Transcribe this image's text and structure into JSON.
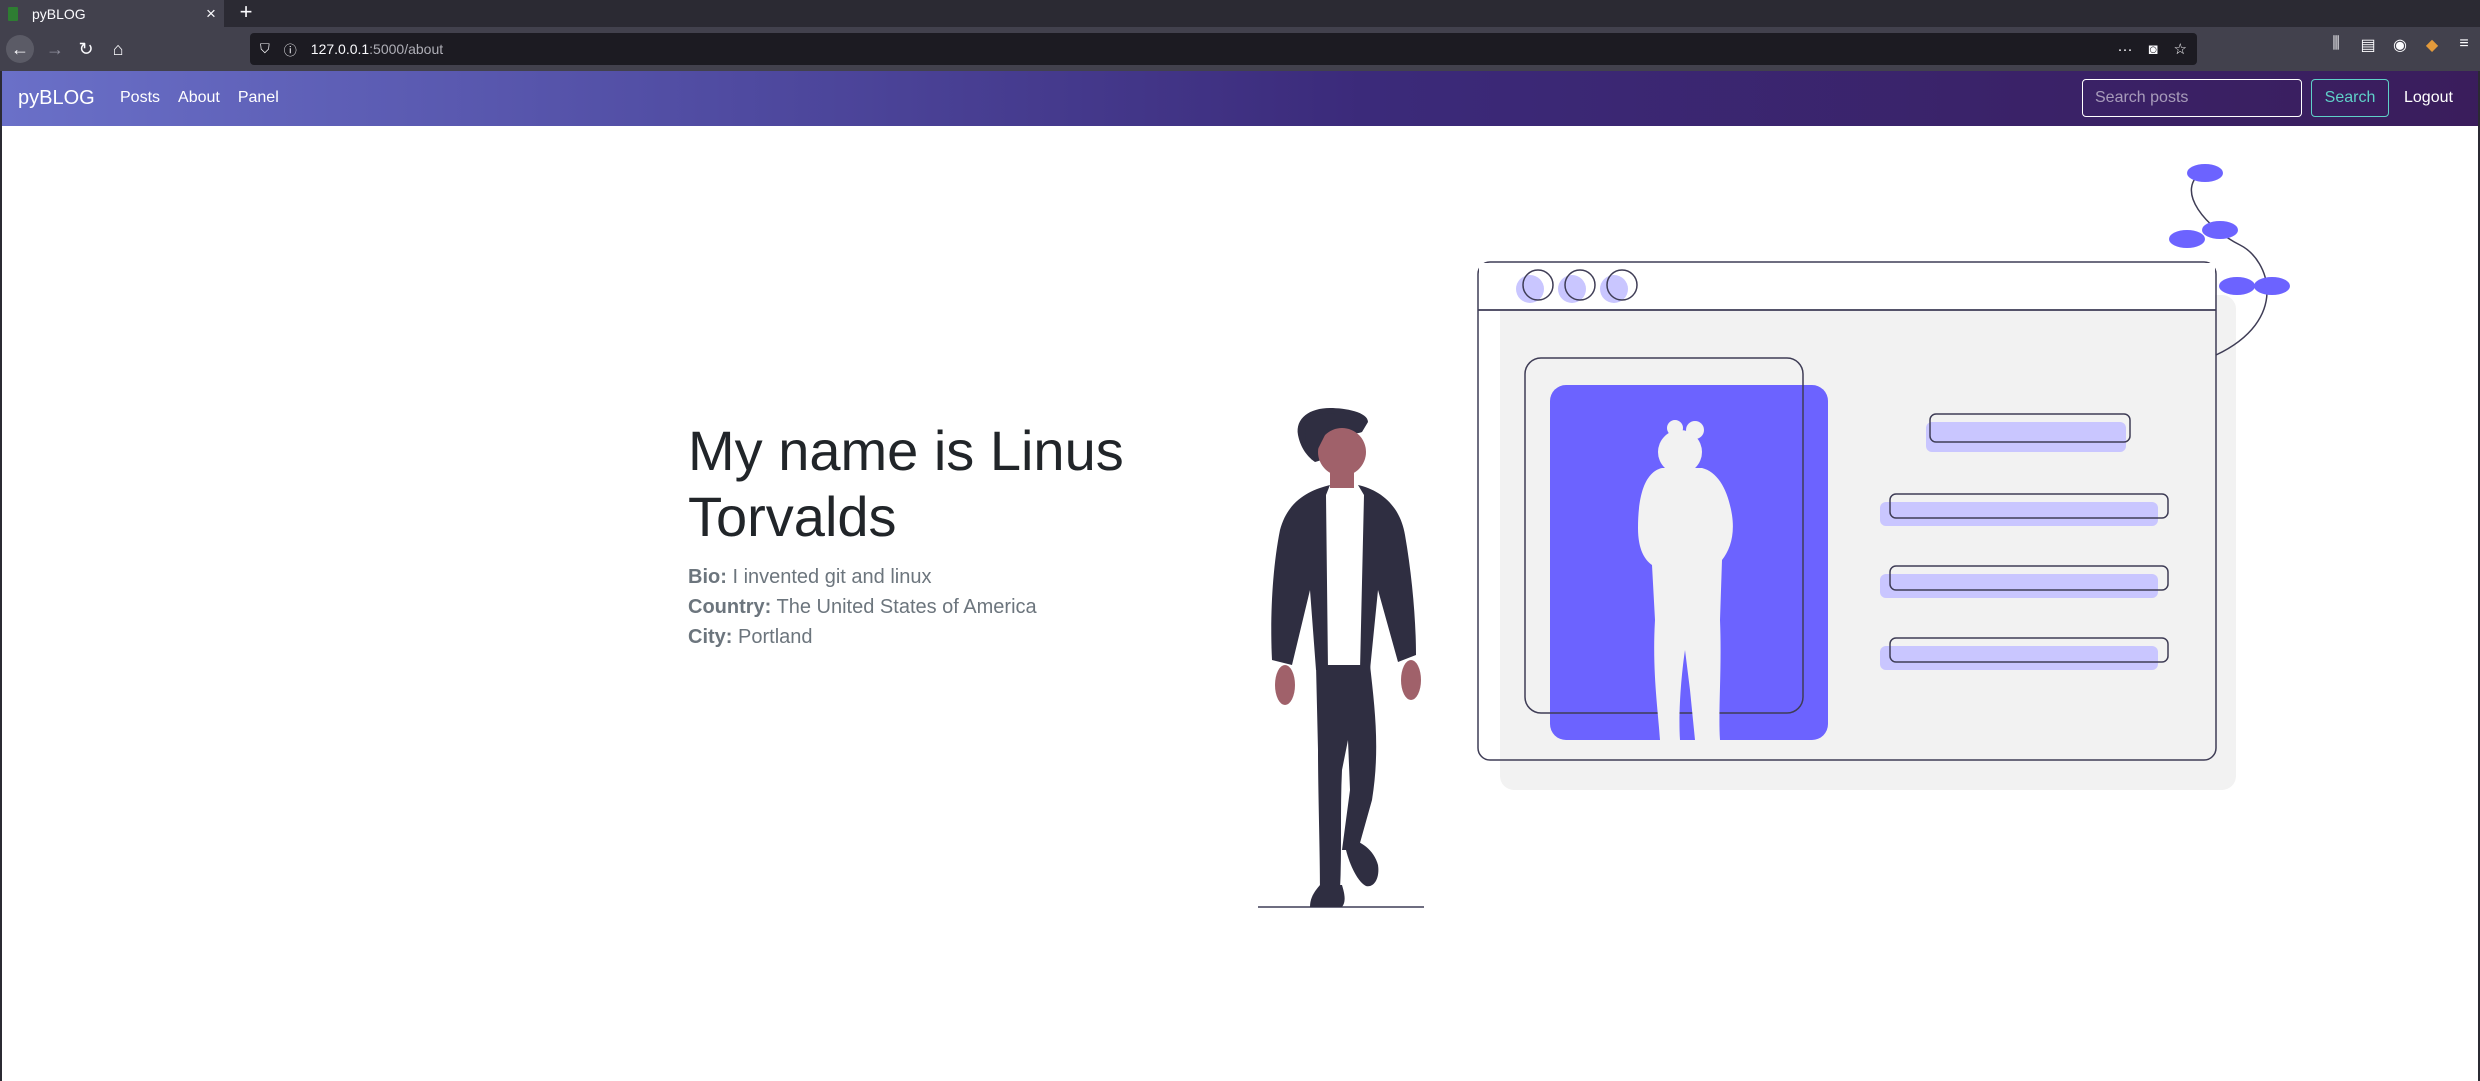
{
  "browser": {
    "tab_title": "pyBLOG",
    "tab_close": "×",
    "new_tab": "+",
    "url_host": "127.0.0.1",
    "url_path": ":5000/about",
    "more_glyph": "···"
  },
  "navbar": {
    "brand": "pyBLOG",
    "links": [
      "Posts",
      "About",
      "Panel"
    ],
    "search_placeholder": "Search posts",
    "search_button": "Search",
    "logout": "Logout"
  },
  "profile": {
    "heading": "My name is Linus Torvalds",
    "bio_label": "Bio:",
    "bio_value": "I invented git and linux",
    "country_label": "Country:",
    "country_value": "The United States of America",
    "city_label": "City:",
    "city_value": "Portland"
  },
  "colors": {
    "accent": "#6c63ff",
    "accent_light": "#c9c6ff",
    "figure_dark": "#2f2e41",
    "skin": "#a0616a"
  }
}
